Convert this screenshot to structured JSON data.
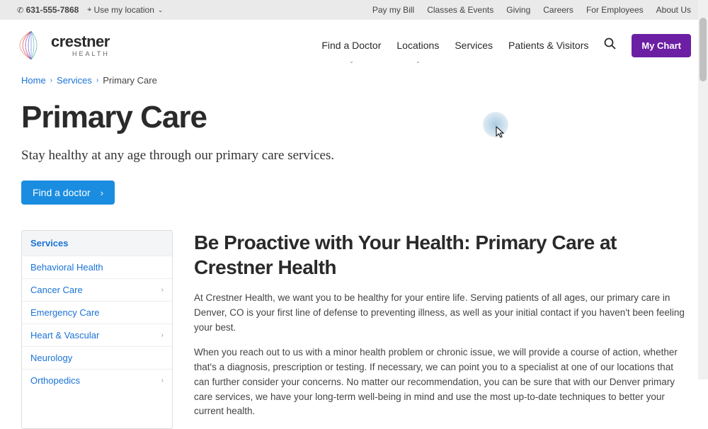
{
  "utility": {
    "phone": "631-555-7868",
    "location_label": "Use my location",
    "links": [
      "Pay my Bill",
      "Classes & Events",
      "Giving",
      "Careers",
      "For Employees",
      "About Us"
    ]
  },
  "logo": {
    "name": "crestner",
    "sub": "HEALTH"
  },
  "nav": {
    "items": [
      "Find a Doctor",
      "Locations",
      "Services",
      "Patients & Visitors"
    ],
    "my_chart": "My Chart"
  },
  "breadcrumb": {
    "home": "Home",
    "services": "Services",
    "current": "Primary Care"
  },
  "hero": {
    "title": "Primary Care",
    "sub": "Stay healthy at any age through our primary care services.",
    "cta": "Find a doctor"
  },
  "sidebar": {
    "header": "Services",
    "items": [
      {
        "label": "Behavioral Health",
        "expandable": false
      },
      {
        "label": "Cancer Care",
        "expandable": true
      },
      {
        "label": "Emergency Care",
        "expandable": false
      },
      {
        "label": "Heart & Vascular",
        "expandable": true
      },
      {
        "label": "Neurology",
        "expandable": false
      },
      {
        "label": "Orthopedics",
        "expandable": true
      }
    ]
  },
  "main": {
    "section_title": "Be Proactive with Your Health: Primary Care at Crestner Health",
    "p1": "At Crestner Health, we want you to be healthy for your entire life. Serving patients of all ages, our primary care in Denver, CO is your first line of defense to preventing illness, as well as your initial contact if you haven't been feeling your best.",
    "p2": "When you reach out to us with a minor health problem or chronic issue, we will provide a course of action, whether that's a diagnosis, prescription or testing. If necessary, we can point you to a specialist at one of our locations that can further consider your concerns. No matter our recommendation, you can be sure that with our Denver primary care services, we have your long-term well-being in mind and use the most up-to-date techniques to better your current health."
  }
}
